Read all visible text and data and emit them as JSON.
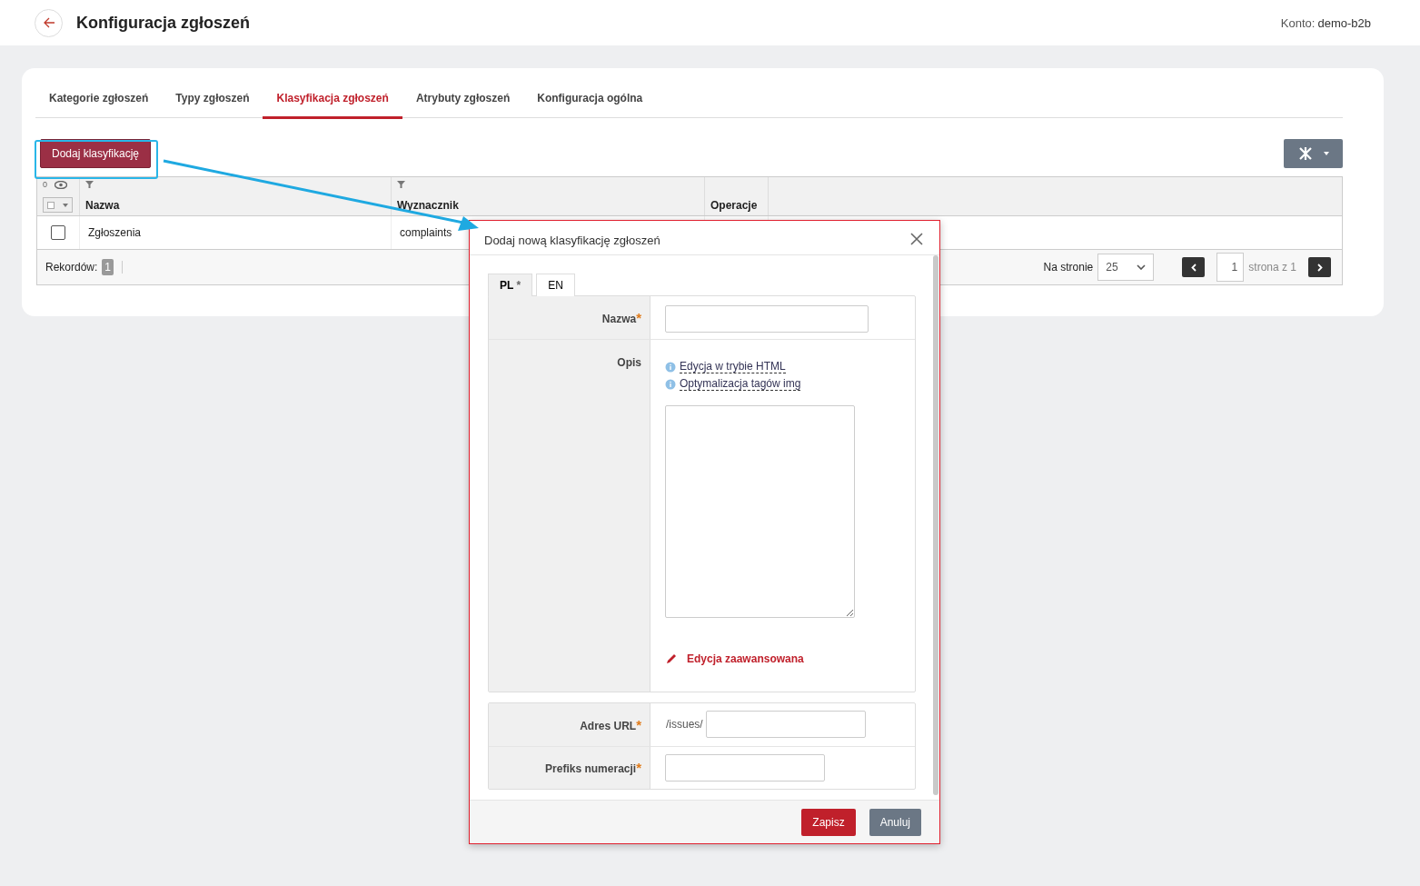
{
  "header": {
    "title": "Konfiguracja zgłoszeń",
    "account_label": "Konto:",
    "account": "demo-b2b"
  },
  "tabs": [
    {
      "label": "Kategorie zgłoszeń",
      "selected": false
    },
    {
      "label": "Typy zgłoszeń",
      "selected": false
    },
    {
      "label": "Klasyfikacja zgłoszeń",
      "selected": true
    },
    {
      "label": "Atrybuty zgłoszeń",
      "selected": false
    },
    {
      "label": "Konfiguracja ogólna",
      "selected": false
    }
  ],
  "add_button": "Dodaj klasyfikację",
  "table": {
    "visible_count": "0",
    "columns": [
      "Nazwa",
      "Wyznacznik",
      "Operacje"
    ],
    "rows": [
      {
        "checked": false,
        "cells": [
          "Zgłoszenia",
          "complaints"
        ]
      }
    ],
    "footer": {
      "records_label": "Rekordów:",
      "records": "1",
      "per_page_label": "Na stronie",
      "per_page": "25",
      "page": "1",
      "page_of": "strona z 1"
    }
  },
  "dialog": {
    "title": "Dodaj nową klasyfikację zgłoszeń",
    "lang_tabs": [
      {
        "label": "PL",
        "required": true,
        "selected": true
      },
      {
        "label": "EN",
        "required": false,
        "selected": false
      }
    ],
    "required_mark": "*",
    "name_label": "Nazwa",
    "name_required": true,
    "description_label": "Opis",
    "help_links": [
      "Edycja w trybie HTML",
      "Optymalizacja tagów img"
    ],
    "advanced_link": "Edycja zaawansowana",
    "url_label": "Adres URL",
    "url_required": true,
    "url_prefix": "/issues/",
    "prefix_label": "Prefiks numeracji",
    "prefix_required": true,
    "save": "Zapisz",
    "cancel": "Anuluj"
  }
}
